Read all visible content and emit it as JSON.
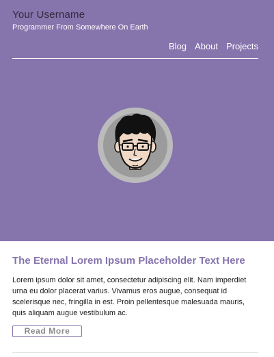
{
  "header": {
    "site_title": "Your Username",
    "tagline": "Programmer From Somewhere On Earth"
  },
  "nav": {
    "items": [
      {
        "label": "Blog"
      },
      {
        "label": "About"
      },
      {
        "label": "Projects"
      }
    ]
  },
  "avatar": {
    "icon": "avatar-face-icon"
  },
  "post": {
    "title": "The Eternal Lorem Ipsum Placeholder Text Here",
    "excerpt": "Lorem ipsum dolor sit amet, consectetur adipiscing elit. Nam imperdiet urna eu dolor placerat varius. Vivamus eros augue, consequat id scelerisque nec, fringilla in est. Proin pellentesque malesuada mauris, quis aliquam augue vestibulum ac.",
    "read_more_label": "Read More"
  },
  "colors": {
    "accent": "#8674ad",
    "hero_background": "#8674ad",
    "title_dark": "#2f2a3d",
    "button_text": "#8a8a8a"
  }
}
